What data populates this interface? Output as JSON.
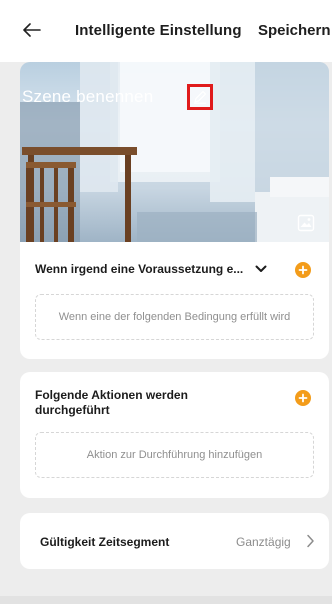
{
  "header": {
    "title": "Intelligente Einstellung",
    "save_label": "Speichern"
  },
  "scene": {
    "title": "Szene benennen"
  },
  "condition_card": {
    "heading": "Wenn irgend eine Voraussetzung e...",
    "placeholder": "Wenn eine der folgenden Bedingung erfüllt wird"
  },
  "action_card": {
    "heading": "Folgende Aktionen werden durchgeführt",
    "placeholder": "Aktion zur Durchführung hinzufügen"
  },
  "time_card": {
    "label": "Gültigkeit Zeitsegment",
    "value": "Ganztägig"
  },
  "colors": {
    "accent": "#f39c1a",
    "highlight": "#e01b1b",
    "background": "#ededed"
  }
}
